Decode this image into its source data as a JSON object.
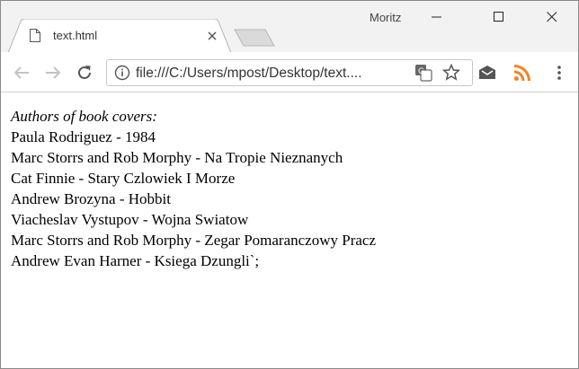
{
  "window": {
    "user": "Moritz"
  },
  "tab": {
    "title": "text.html"
  },
  "toolbar": {
    "url": "file:///C:/Users/mpost/Desktop/text...."
  },
  "page": {
    "heading": "Authors of book covers:",
    "lines": [
      "Paula Rodriguez - 1984",
      "Marc Storrs and Rob Morphy - Na Tropie Nieznanych",
      "Cat Finnie - Stary Czlowiek I Morze",
      "Andrew Brozyna - Hobbit",
      "Viacheslav Vystupov - Wojna Swiatow",
      "Marc Storrs and Rob Morphy - Zegar Pomaranczowy Pracz",
      "Andrew Evan Harner - Ksiega Dzungli`;"
    ]
  },
  "colors": {
    "rss_orange": "#f58220",
    "titlebar": "#f2f2f2"
  }
}
